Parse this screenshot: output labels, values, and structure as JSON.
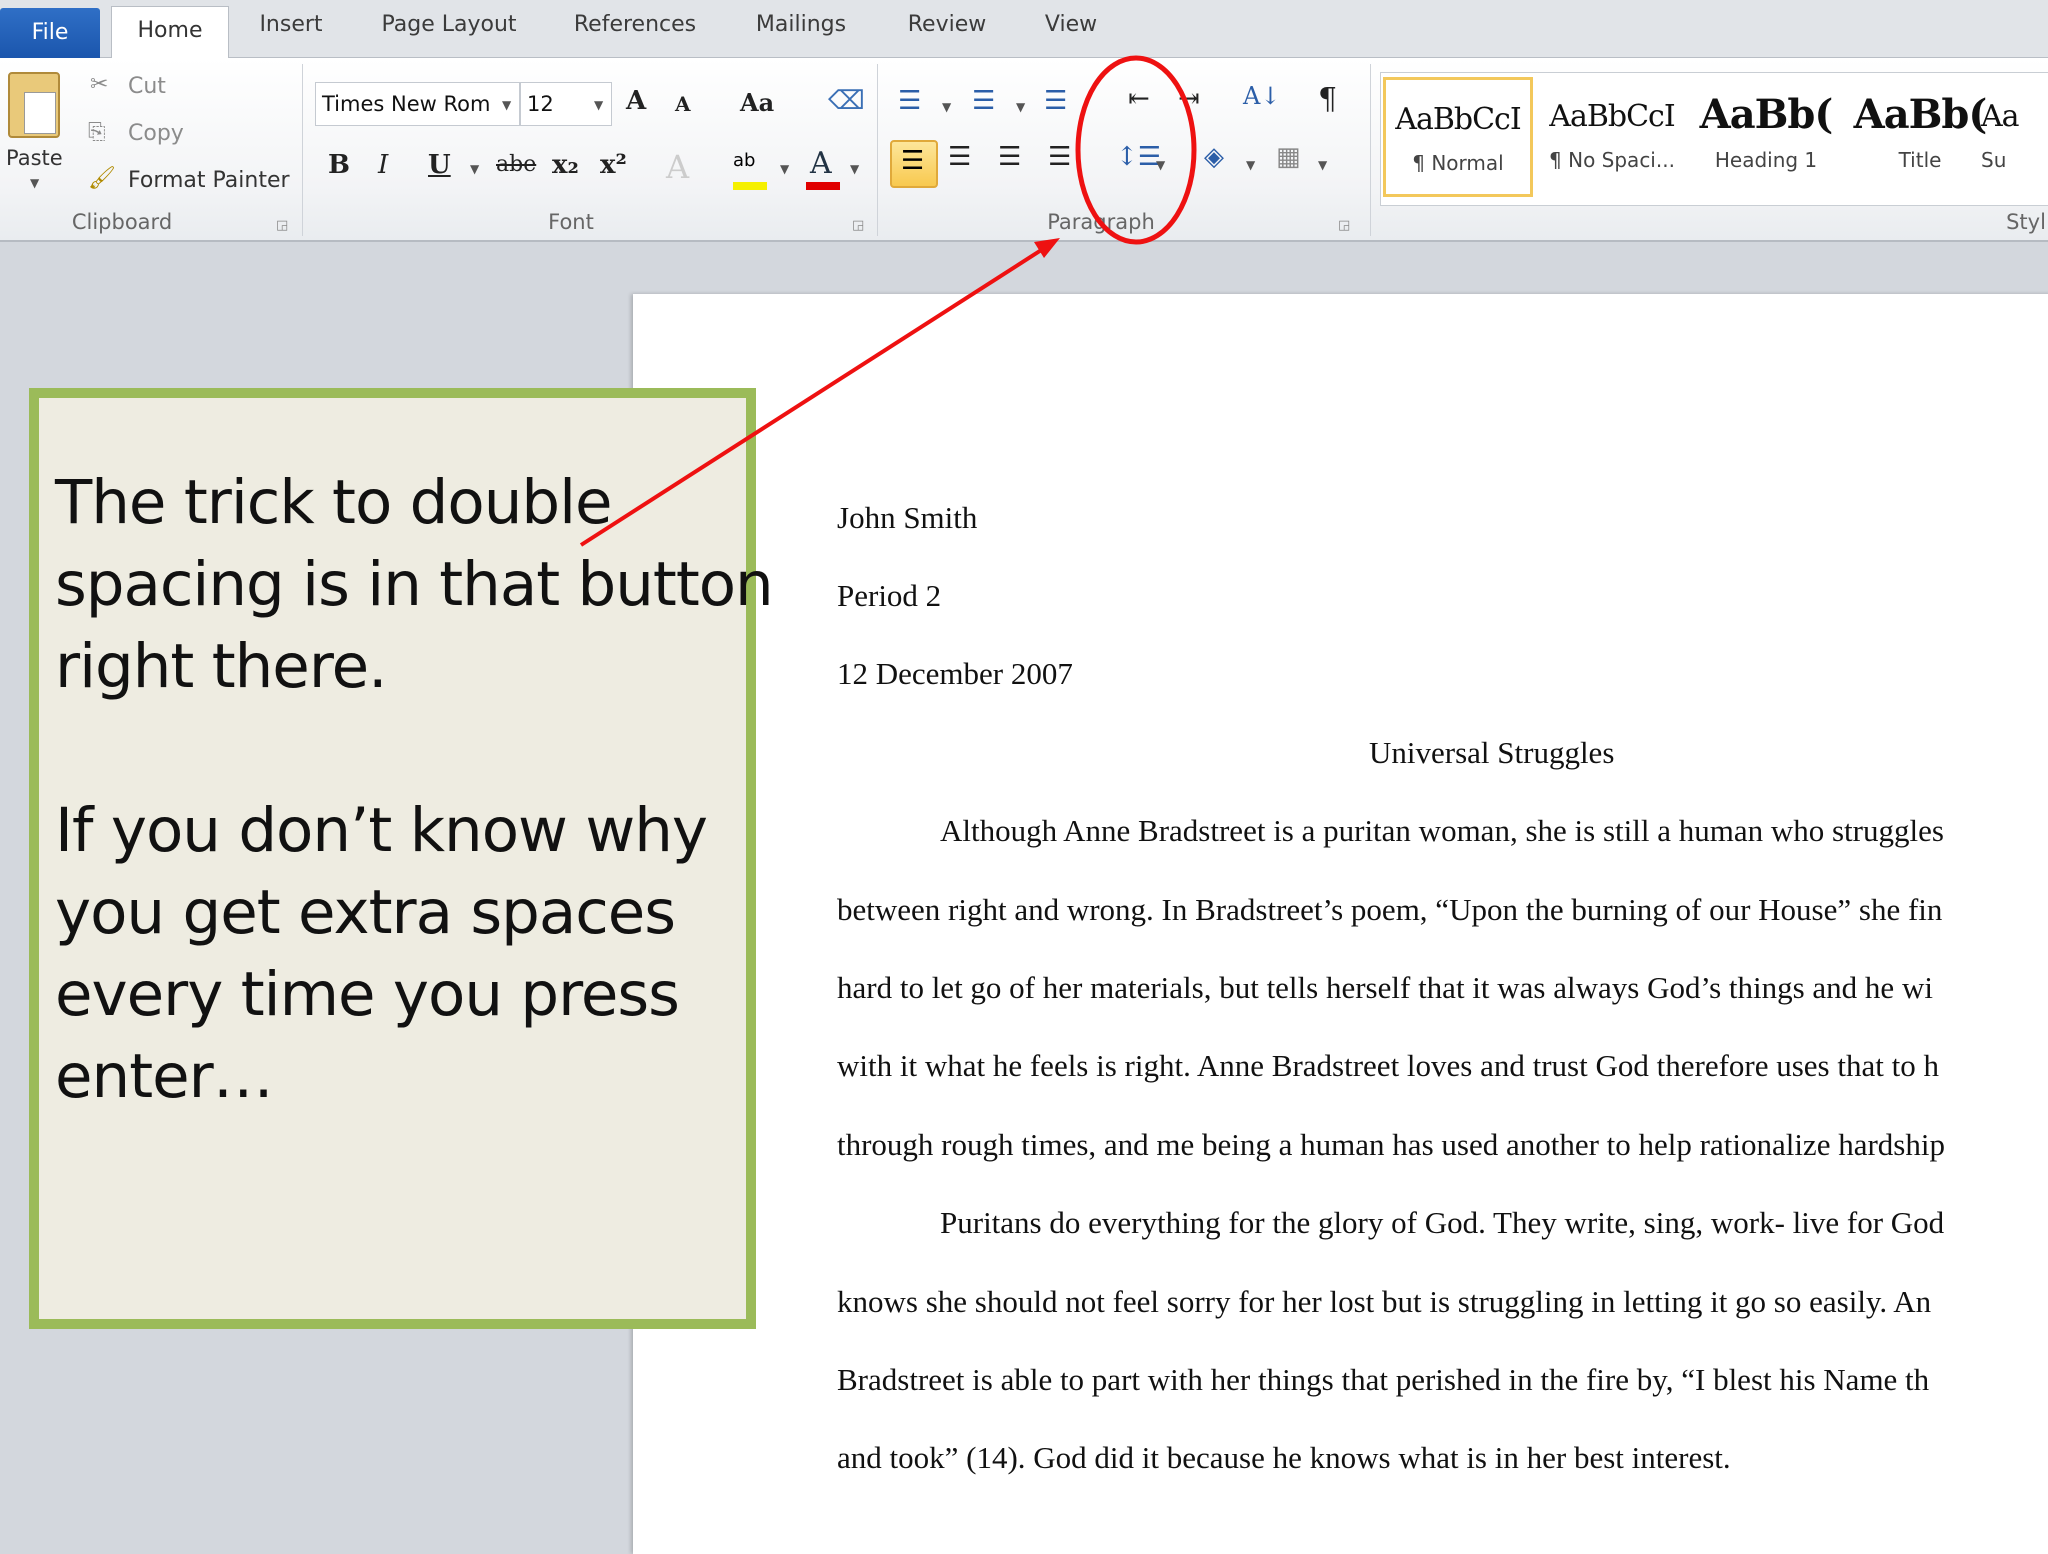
{
  "tabs": {
    "file": "File",
    "home": "Home",
    "insert": "Insert",
    "page_layout": "Page Layout",
    "references": "References",
    "mailings": "Mailings",
    "review": "Review",
    "view": "View"
  },
  "clipboard": {
    "paste": "Paste",
    "cut": "Cut",
    "copy": "Copy",
    "format_painter": "Format Painter",
    "label": "Clipboard"
  },
  "font": {
    "name": "Times New Rom",
    "size": "12",
    "label": "Font",
    "bold": "B",
    "italic": "I",
    "underline": "U",
    "strike": "abe",
    "grow": "A",
    "change_case": "Aa",
    "color": "A"
  },
  "paragraph": {
    "label": "Paragraph"
  },
  "styles": {
    "label": "Styl",
    "items": [
      {
        "preview": "AaBbCcI",
        "name": "¶ Normal"
      },
      {
        "preview": "AaBbCcI",
        "name": "¶ No Spaci..."
      },
      {
        "preview": "AaBb(",
        "name": "Heading 1"
      },
      {
        "preview": "AaBb(",
        "name": "Title"
      },
      {
        "preview": "Aa",
        "name": "Su"
      }
    ]
  },
  "colors": {
    "highlight": "#f5f000",
    "font_color": "#e00000",
    "annotation": "#ee1111",
    "callout_border": "#9bbb59"
  },
  "callout": {
    "lines": [
      "The trick to double",
      "spacing is in that button",
      "right there.",
      "If you don’t know why",
      "you get extra spaces",
      "every time you press",
      "enter…"
    ]
  },
  "document": {
    "lines": [
      "John Smith",
      "Period 2",
      "12 December 2007",
      "Universal Struggles",
      "Although Anne Bradstreet is a puritan woman, she is still a human who struggles",
      "between right and wrong. In Bradstreet’s poem, “Upon the burning of our House” she fin",
      "hard to let go of her materials, but tells herself that it was always God’s things and he wi",
      "with it what he feels is right.  Anne Bradstreet loves and trust God therefore uses that to h",
      "through rough times, and me being a human has used another to help rationalize hardship",
      "Puritans do everything for the glory of God. They write, sing, work- live for God",
      "knows she should not feel sorry for her lost but is struggling in letting it go so easily.  An",
      "Bradstreet is able to part with her things that perished in the fire by, “I blest his Name th",
      "and took” (14).  God did it because he knows what is in her best interest."
    ]
  }
}
